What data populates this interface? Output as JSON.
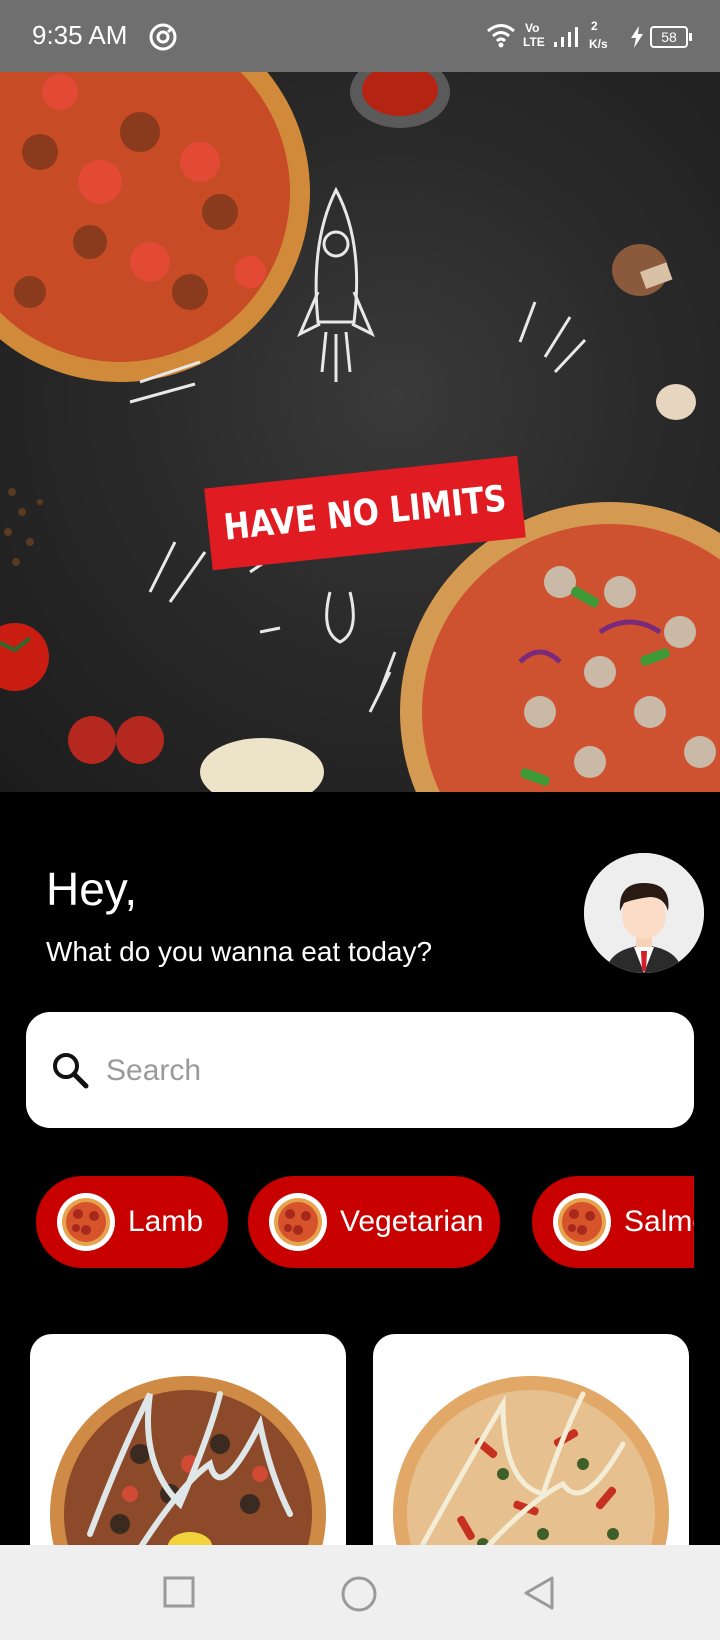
{
  "status_bar": {
    "time": "9:35 AM",
    "network_top": "Vo",
    "network_bottom": "LTE",
    "speed_value": "2",
    "speed_unit": "K/s",
    "battery": "58"
  },
  "hero": {
    "banner_text": "HAVE NO LIMITS"
  },
  "greeting": {
    "title": "Hey,",
    "subtitle": "What do you wanna eat today?"
  },
  "search": {
    "placeholder": "Search",
    "value": ""
  },
  "categories": [
    {
      "label": "Lamb"
    },
    {
      "label": "Vegetarian"
    },
    {
      "label": "Salmon"
    }
  ],
  "colors": {
    "accent": "#c80000",
    "banner": "#e01b22",
    "background": "#000000"
  },
  "nav_bar": {
    "icons": [
      "recent-apps-icon",
      "home-icon",
      "back-icon"
    ]
  }
}
